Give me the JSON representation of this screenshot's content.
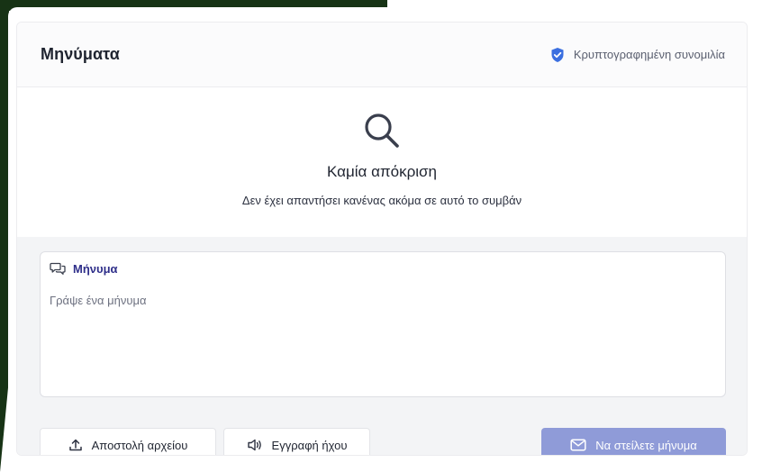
{
  "header": {
    "title": "Μηνύματα",
    "encrypted_label": "Κρυπτογραφημένη συνομιλία"
  },
  "empty_state": {
    "title": "Καμία απόκριση",
    "subtitle": "Δεν έχει απαντήσει κανένας ακόμα σε αυτό το συμβάν"
  },
  "composer": {
    "label": "Μήνυμα",
    "value": "",
    "placeholder": "Γράψε ένα μήνυμα"
  },
  "actions": {
    "upload_label": "Αποστολή αρχείου",
    "audio_label": "Εγγραφή ήχου",
    "send_label": "Να στείλετε μήνυμα"
  },
  "icons": {
    "shield": "shield-check-icon",
    "search": "search-icon",
    "chat": "chat-bubbles-icon",
    "upload": "upload-icon",
    "audio": "speaker-icon",
    "send": "envelope-icon"
  },
  "colors": {
    "shield": "#3b6fe0",
    "accent_label": "#2f2f8a",
    "send_button": "#8f9bd8",
    "background_dark": "#173315"
  }
}
